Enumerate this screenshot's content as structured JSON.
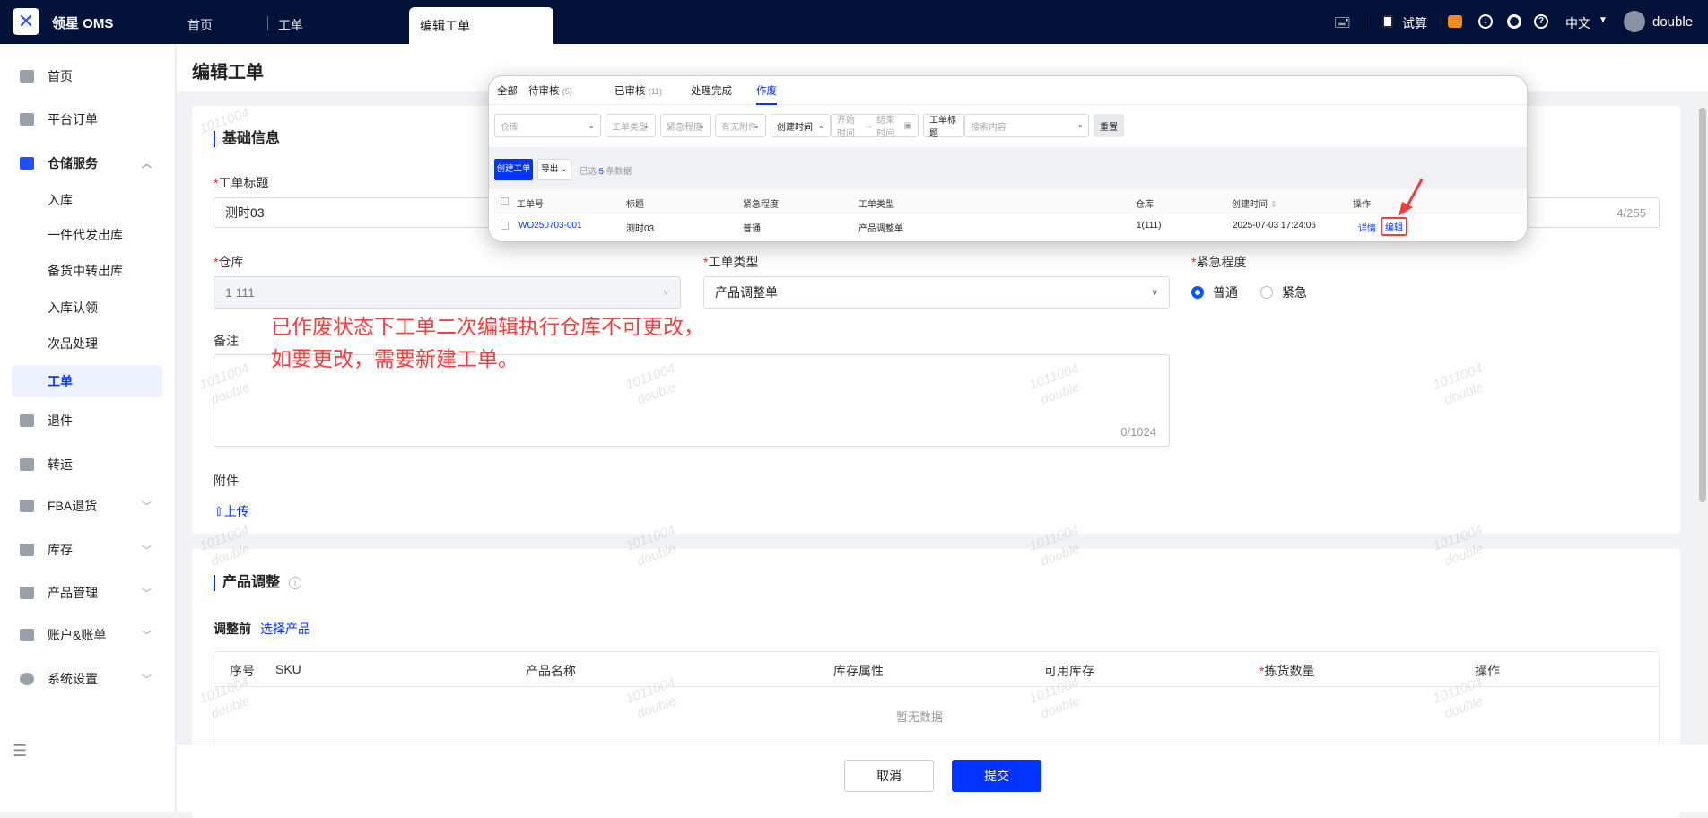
{
  "app": {
    "name": "领星 OMS"
  },
  "tabs": [
    {
      "label": "首页"
    },
    {
      "label": "工单"
    },
    {
      "label": "编辑工单"
    }
  ],
  "header_right": {
    "trial": "试算",
    "language": "中文",
    "user": "double"
  },
  "sidebar": {
    "items": [
      {
        "label": "首页"
      },
      {
        "label": "平台订单"
      },
      {
        "label": "仓储服务"
      },
      {
        "label": "入库"
      },
      {
        "label": "一件代发出库"
      },
      {
        "label": "备货中转出库"
      },
      {
        "label": "入库认领"
      },
      {
        "label": "次品处理"
      },
      {
        "label": "工单"
      },
      {
        "label": "退件"
      },
      {
        "label": "转运"
      },
      {
        "label": "FBA退货"
      },
      {
        "label": "库存"
      },
      {
        "label": "产品管理"
      },
      {
        "label": "账户&账单"
      },
      {
        "label": "系统设置"
      }
    ]
  },
  "page": {
    "title": "编辑工单"
  },
  "basic": {
    "title": "基础信息",
    "title_label": "工单标题",
    "title_value": "测时03",
    "title_count": "4/255",
    "warehouse_label": "仓库",
    "warehouse_value": "1 111",
    "type_label": "工单类型",
    "type_value": "产品调整单",
    "urgency_label": "紧急程度",
    "urgency_options": [
      "普通",
      "紧急"
    ],
    "urgency_selected": "普通",
    "remark_label": "备注",
    "remark_count": "0/1024",
    "attachment_label": "附件",
    "upload": "上传"
  },
  "annotation": {
    "line1": "已作废状态下工单二次编辑执行仓库不可更改，",
    "line2": "如要更改，需要新建工单。"
  },
  "product": {
    "title": "产品调整",
    "before": "调整前",
    "select_product": "选择产品",
    "columns": [
      "序号",
      "SKU",
      "产品名称",
      "库存属性",
      "可用库存",
      "拣货数量",
      "操作"
    ],
    "empty": "暂无数据"
  },
  "footer": {
    "cancel": "取消",
    "submit": "提交"
  },
  "popup": {
    "tabs": [
      {
        "label": "全部",
        "count": ""
      },
      {
        "label": "待审核",
        "count": "(5)"
      },
      {
        "label": "已审核",
        "count": "(11)"
      },
      {
        "label": "处理完成",
        "count": ""
      },
      {
        "label": "作废",
        "count": ""
      }
    ],
    "filters": {
      "warehouse": "仓库",
      "type": "工单类型",
      "urgency": "紧急程度",
      "attachment": "有无附件",
      "time_field": "创建时间",
      "start": "开始时间",
      "arrow": "→",
      "end": "结束时间",
      "search_field": "工单标题",
      "search_placeholder": "搜索内容",
      "reset": "重置"
    },
    "create": "创建工单",
    "export": "导出",
    "selected_prefix": "已选",
    "selected_count": "5",
    "selected_suffix": "条数据",
    "columns": [
      "工单号",
      "标题",
      "紧急程度",
      "工单类型",
      "仓库",
      "创建时间",
      "操作"
    ],
    "row": {
      "id": "WO250703-001",
      "title": "测时03",
      "urgency": "普通",
      "type": "产品调整单",
      "warehouse": "1(111)",
      "created": "2025-07-03 17:24:06",
      "detail": "详情",
      "edit": "编辑"
    }
  },
  "watermark": {
    "line1": "1011004",
    "line2": "double"
  },
  "colors": {
    "topbar": "#021239",
    "primary": "#0033ff",
    "annotation": "#f04040"
  }
}
